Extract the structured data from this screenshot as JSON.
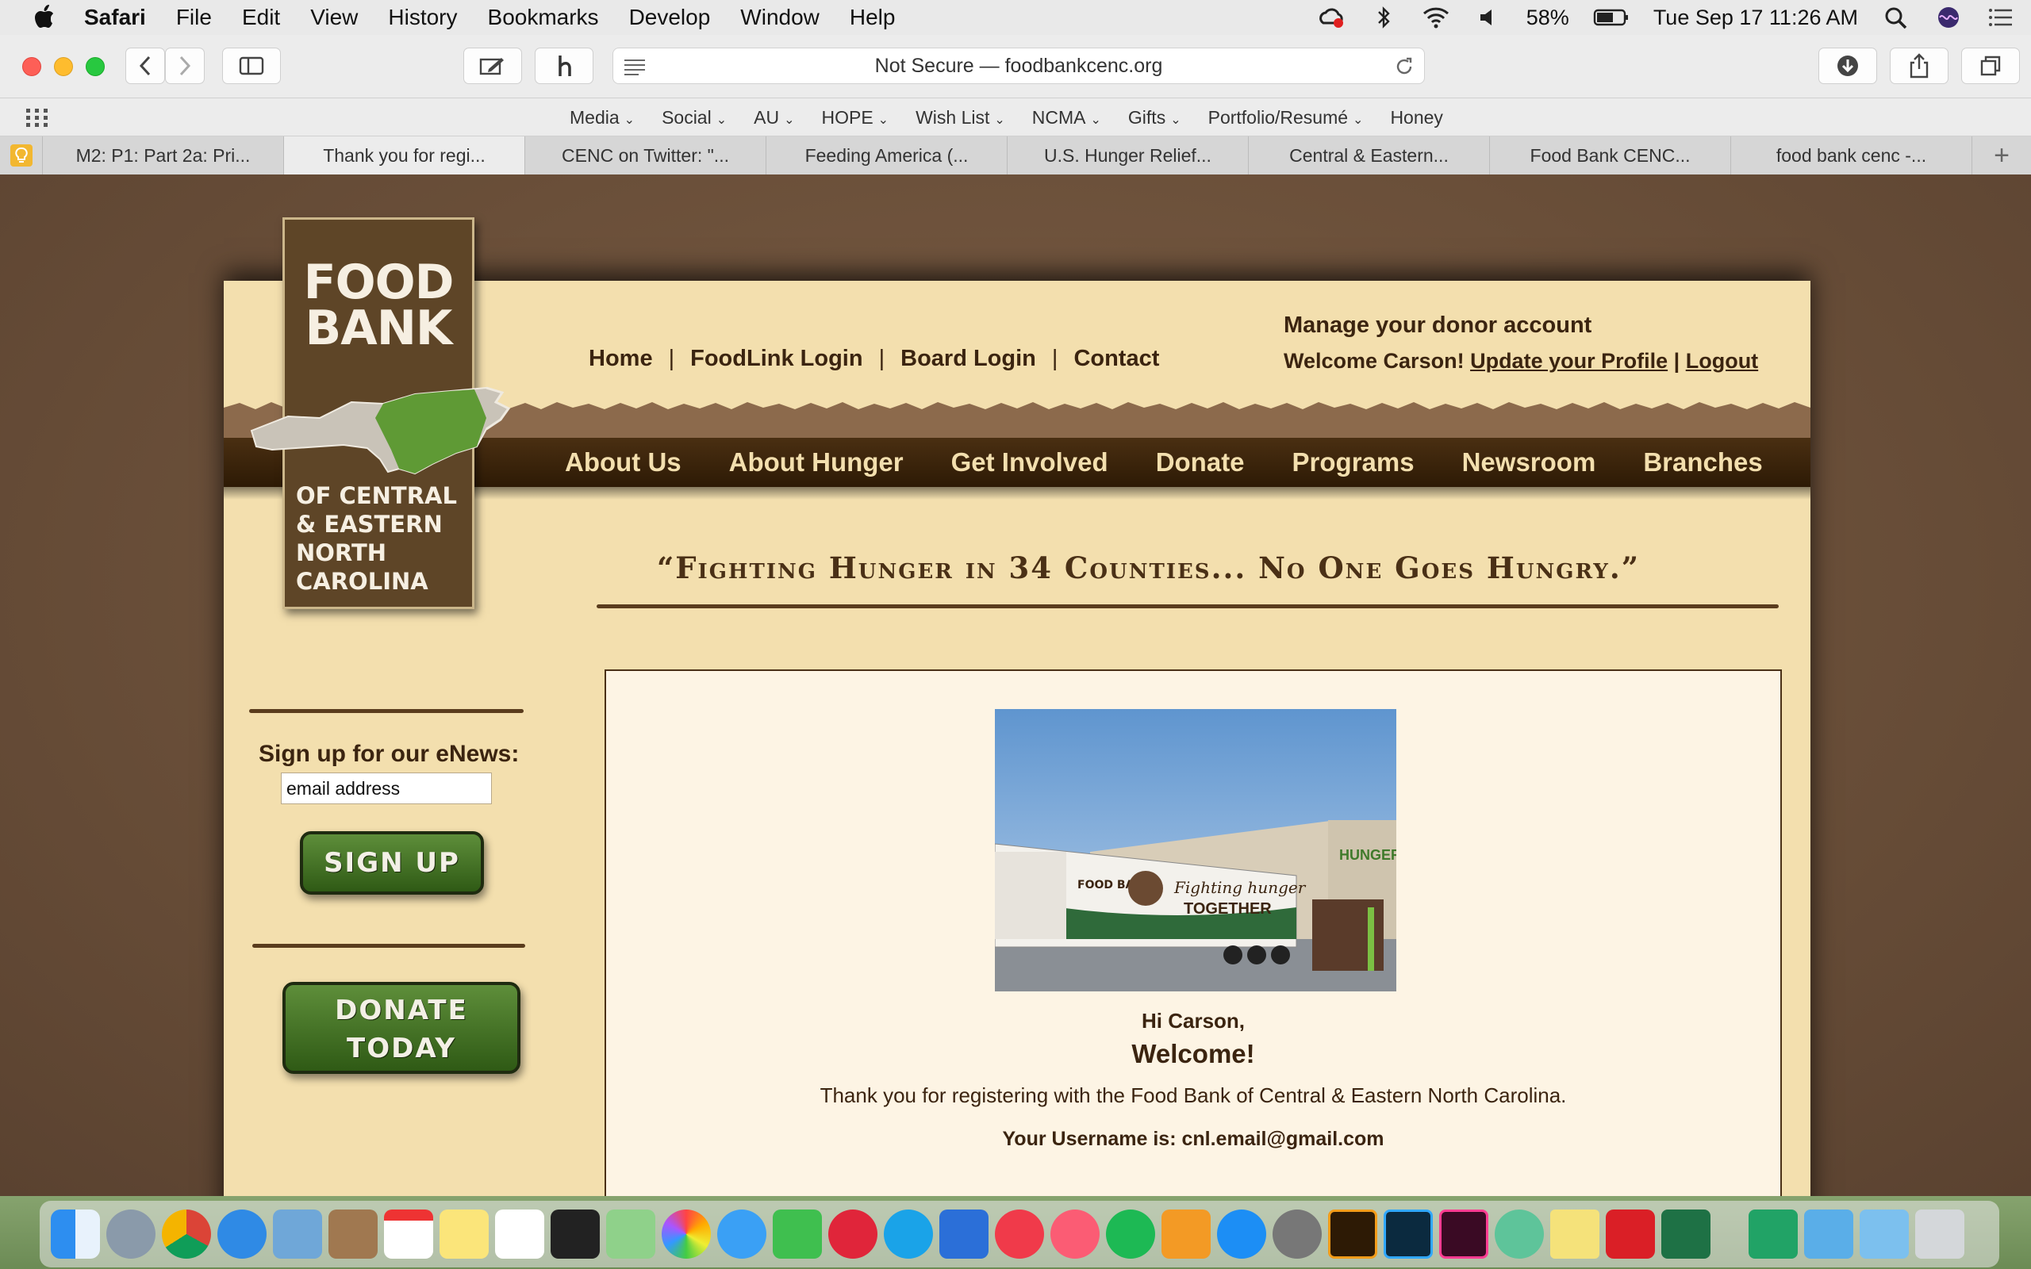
{
  "menubar": {
    "app": "Safari",
    "items": [
      "File",
      "Edit",
      "View",
      "History",
      "Bookmarks",
      "Develop",
      "Window",
      "Help"
    ],
    "battery": "58%",
    "clock": "Tue Sep 17  11:26 AM"
  },
  "toolbar": {
    "url": "Not Secure — foodbankcenc.org"
  },
  "favorites": [
    {
      "label": "Media"
    },
    {
      "label": "Social"
    },
    {
      "label": "AU"
    },
    {
      "label": "HOPE"
    },
    {
      "label": "Wish List"
    },
    {
      "label": "NCMA"
    },
    {
      "label": "Gifts"
    },
    {
      "label": "Portfolio/Resumé"
    },
    {
      "label": "Honey"
    }
  ],
  "tabs": [
    {
      "label": "M2: P1: Part 2a: Pri..."
    },
    {
      "label": "Thank you for regi..."
    },
    {
      "label": "CENC on Twitter: \"..."
    },
    {
      "label": "Feeding America (..."
    },
    {
      "label": "U.S. Hunger Relief..."
    },
    {
      "label": "Central & Eastern..."
    },
    {
      "label": "Food Bank CENC..."
    },
    {
      "label": "food bank cenc -..."
    }
  ],
  "site": {
    "logo": {
      "line1": "FOOD",
      "line2": "BANK",
      "sub1": "OF CENTRAL",
      "sub2": "& EASTERN",
      "sub3": "NORTH",
      "sub4": "CAROLINA"
    },
    "utility_nav": [
      "Home",
      "FoodLink Login",
      "Board Login",
      "Contact"
    ],
    "donor": {
      "title": "Manage your donor account",
      "welcome": "Welcome Carson!",
      "update": "Update your Profile",
      "sep": "|",
      "logout": "Logout"
    },
    "main_nav": [
      "About Us",
      "About Hunger",
      "Get Involved",
      "Donate",
      "Programs",
      "Newsroom",
      "Branches"
    ],
    "slogan": "“Fighting Hunger in 34 Counties... No One Goes Hungry.”",
    "sidebar": {
      "enews_title": "Sign up for our eNews:",
      "email_value": "email address",
      "signup": "SIGN UP",
      "donate1": "DONATE",
      "donate2": "TODAY"
    },
    "content": {
      "photo_text1": "Fighting hunger",
      "photo_text2": "TOGETHER",
      "photo_building": "HUNGER",
      "photo_truck": "FOOD BANK",
      "hi": "Hi Carson,",
      "welcome": "Welcome!",
      "thanks": "Thank you for registering with the Food Bank of Central & Eastern North Carolina.",
      "username": "Your Username is: cnl.email@gmail.com"
    }
  },
  "colors": {
    "accent_brown": "#3b2410",
    "header_bg": "#f3dfae",
    "nav_bg": "#3a2309",
    "button_green": "#3f6e22"
  }
}
